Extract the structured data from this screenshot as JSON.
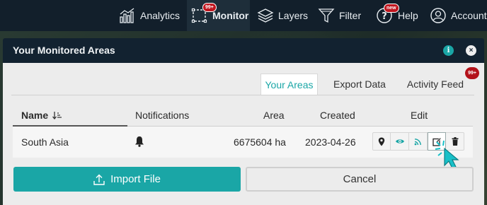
{
  "nav": {
    "analytics_label": "Analytics",
    "monitor_label": "Monitor",
    "monitor_badge": "99+",
    "layers_label": "Layers",
    "filter_label": "Filter",
    "help_label": "Help",
    "help_badge": "new",
    "account_label": "Account"
  },
  "dialog": {
    "title": "Your Monitored Areas",
    "info_icon": "i",
    "close_icon": "×"
  },
  "tabs": {
    "items": [
      {
        "label": "Your Areas",
        "active": true
      },
      {
        "label": "Export Data",
        "active": false
      },
      {
        "label": "Activity Feed",
        "active": false
      }
    ],
    "activity_badge": "99+"
  },
  "table": {
    "headers": {
      "name": "Name",
      "notifications": "Notifications",
      "area": "Area",
      "created": "Created",
      "edit": "Edit"
    },
    "sort_icon": "sort-ascending-icon",
    "rows": [
      {
        "name": "South Asia",
        "notification_icon": "bell-icon",
        "area": "6675604 ha",
        "created": "2023-04-26",
        "actions": [
          "map-pin-icon",
          "eye-icon",
          "rss-icon",
          "edit-icon",
          "trash-icon"
        ]
      }
    ]
  },
  "footer": {
    "import_label": "Import File",
    "cancel_label": "Cancel"
  },
  "colors": {
    "accent": "#1aa6a6",
    "nav_bg": "#121f2b",
    "badge_red": "#c0161f"
  }
}
